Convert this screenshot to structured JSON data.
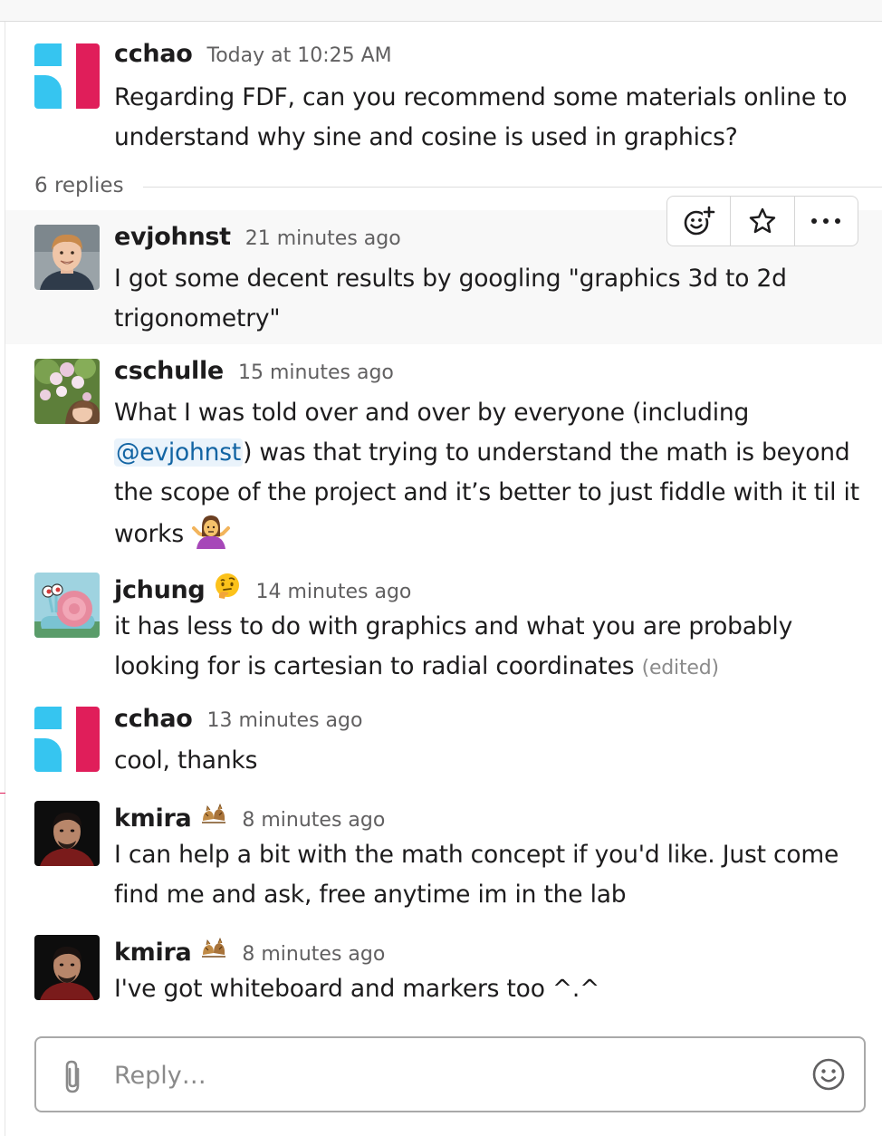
{
  "thread": {
    "replies_label": "6 replies",
    "parent": {
      "author": "cchao",
      "time": "Today at 10:25 AM",
      "text": "Regarding FDF, can you recommend some materials online to understand why sine and cosine is used in graphics?"
    },
    "messages": [
      {
        "author": "evjohnst",
        "time": "21 minutes ago",
        "text": "I got some decent results by googling \"graphics 3d to 2d trigonometry\""
      },
      {
        "author": "cschulle",
        "time": "15 minutes ago",
        "text_before": "What I was told over and over by everyone (including ",
        "mention": "@evjohnst",
        "text_after": ") was that trying to understand the math is beyond the scope of the project and it’s better to just fiddle with it til it works",
        "emoji": "person-shrugging"
      },
      {
        "author": "jchung",
        "status_emoji": "thinking-face",
        "time": "14 minutes ago",
        "text": "it has less to do with graphics and what you are probably looking for is cartesian to radial coordinates",
        "edited_label": "(edited)"
      },
      {
        "author": "cchao",
        "time": "13 minutes ago",
        "text": "cool, thanks"
      },
      {
        "author": "kmira",
        "status_emoji": "fighting-cats",
        "time": "8 minutes ago",
        "text": "I can help a bit with the math concept if you'd like. Just come find me and ask, free anytime im in the lab"
      },
      {
        "author": "kmira",
        "status_emoji": "fighting-cats",
        "time": "8 minutes ago",
        "text": "I've got whiteboard and markers too ^.^"
      }
    ]
  },
  "message_actions": {
    "icons": [
      "add-reaction-icon",
      "star-icon",
      "more-actions-icon"
    ]
  },
  "composer": {
    "placeholder": "Reply…",
    "icons": [
      "paperclip-icon",
      "emoji-icon"
    ]
  },
  "colors": {
    "text": "#1d1c1d",
    "muted": "#616061",
    "mention": "#1264a3",
    "hover_bg": "#f8f8f8",
    "logo_blue": "#36c5f0",
    "logo_red": "#e01e5a"
  }
}
